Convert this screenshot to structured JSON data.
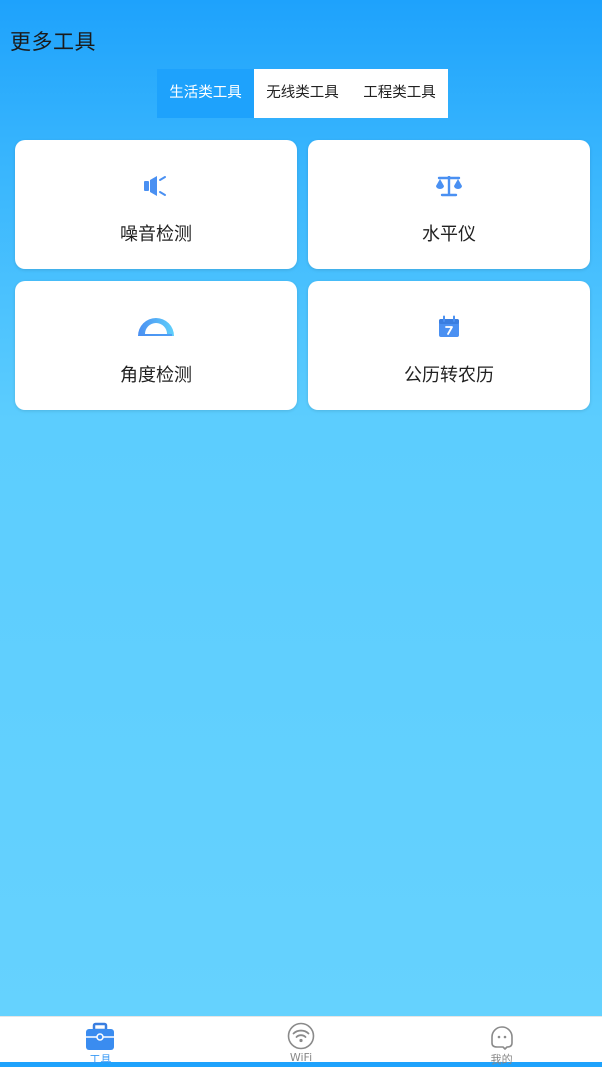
{
  "header": {
    "title": "更多工具"
  },
  "tabs": [
    {
      "label": "生活类工具",
      "active": true
    },
    {
      "label": "无线类工具",
      "active": false
    },
    {
      "label": "工程类工具",
      "active": false
    }
  ],
  "tools": [
    {
      "label": "噪音检测",
      "icon": "speaker-icon"
    },
    {
      "label": "水平仪",
      "icon": "balance-scale-icon"
    },
    {
      "label": "角度检测",
      "icon": "protractor-icon"
    },
    {
      "label": "公历转农历",
      "icon": "calendar-icon"
    }
  ],
  "bottom_nav": [
    {
      "label": "工具",
      "icon": "toolbox-icon",
      "active": true
    },
    {
      "label": "WiFi",
      "icon": "wifi-icon",
      "active": false
    },
    {
      "label": "我的",
      "icon": "profile-icon",
      "active": false
    }
  ],
  "colors": {
    "accent": "#1ea2fc",
    "icon_blue": "#4a90f2",
    "background_bottom": "#66d2fe"
  }
}
